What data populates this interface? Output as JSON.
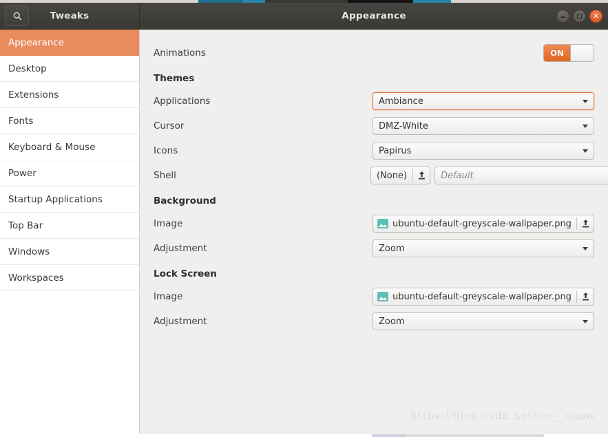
{
  "window": {
    "app_title": "Tweaks",
    "page_title": "Appearance",
    "search_icon": "search-icon",
    "controls": {
      "minimize": "minimize",
      "maximize": "maximize",
      "close": "close"
    }
  },
  "colors": {
    "accent_orange": "#ea8b5e",
    "switch_on": "#e3661f",
    "close_button": "#ed6b38",
    "headerbar": "#3f3d39",
    "content_bg": "#f0efee",
    "image_icon": "#5fbfb4"
  },
  "sidebar": {
    "items": [
      {
        "label": "Appearance",
        "selected": true
      },
      {
        "label": "Desktop",
        "selected": false
      },
      {
        "label": "Extensions",
        "selected": false
      },
      {
        "label": "Fonts",
        "selected": false
      },
      {
        "label": "Keyboard & Mouse",
        "selected": false
      },
      {
        "label": "Power",
        "selected": false
      },
      {
        "label": "Startup Applications",
        "selected": false
      },
      {
        "label": "Top Bar",
        "selected": false
      },
      {
        "label": "Windows",
        "selected": false
      },
      {
        "label": "Workspaces",
        "selected": false
      }
    ]
  },
  "content": {
    "animations": {
      "label": "Animations",
      "switch_state": "ON"
    },
    "themes": {
      "heading": "Themes",
      "applications": {
        "label": "Applications",
        "value": "Ambiance",
        "focused": true
      },
      "cursor": {
        "label": "Cursor",
        "value": "DMZ-White",
        "focused": false
      },
      "icons": {
        "label": "Icons",
        "value": "Papirus",
        "focused": false
      },
      "shell": {
        "label": "Shell",
        "button_text": "(None)",
        "button_icon": "upload-icon",
        "value": "Default",
        "value_is_placeholder": true
      }
    },
    "background": {
      "heading": "Background",
      "image": {
        "label": "Image",
        "value": "ubuntu-default-greyscale-wallpaper.png",
        "icon": "image-file-icon",
        "action_icon": "upload-icon"
      },
      "adjustment": {
        "label": "Adjustment",
        "value": "Zoom"
      }
    },
    "lock_screen": {
      "heading": "Lock Screen",
      "image": {
        "label": "Image",
        "value": "ubuntu-default-greyscale-wallpaper.png",
        "icon": "image-file-icon",
        "action_icon": "upload-icon"
      },
      "adjustment": {
        "label": "Adjustment",
        "value": "Zoom"
      }
    }
  },
  "watermark": {
    "text": "https://blog.csdn.net/ice__snow"
  }
}
